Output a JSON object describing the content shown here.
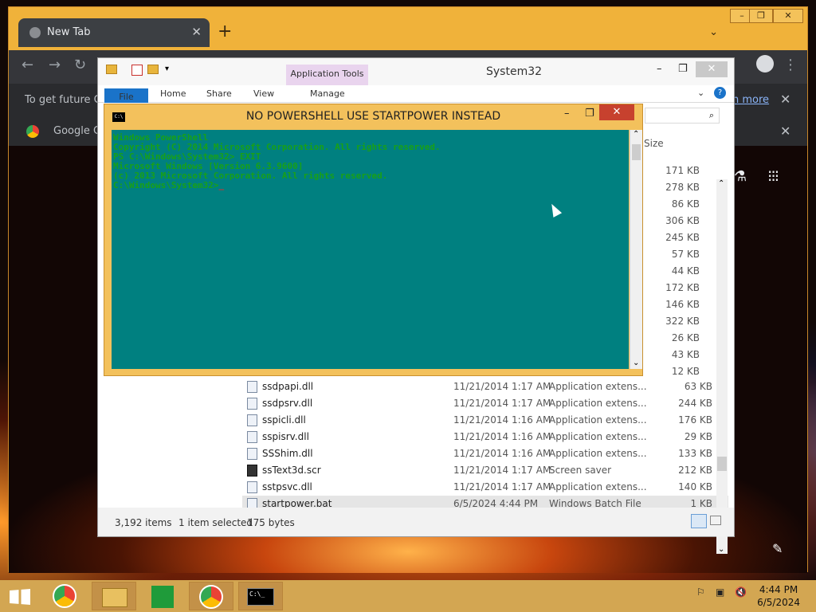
{
  "chrome": {
    "tab_title": "New Tab",
    "tab_close": "✕",
    "new_tab": "+",
    "info_text": "To get future Go",
    "info_link": "n more",
    "bookmark_label": "Google Ch",
    "close_glyph": "✕"
  },
  "explorer": {
    "title": "System32",
    "app_tools": "Application Tools",
    "ribbon": {
      "file": "File",
      "home": "Home",
      "share": "Share",
      "view": "View",
      "manage": "Manage"
    },
    "size_header": "Size",
    "upper_sizes": [
      "171 KB",
      "278 KB",
      "86 KB",
      "306 KB",
      "245 KB",
      "57 KB",
      "44 KB",
      "172 KB",
      "146 KB",
      "322 KB",
      "26 KB",
      "43 KB",
      "12 KB"
    ],
    "files": [
      {
        "name": "ssdpapi.dll",
        "date": "11/21/2014 1:17 AM",
        "type": "Application extens...",
        "size": "63 KB"
      },
      {
        "name": "ssdpsrv.dll",
        "date": "11/21/2014 1:17 AM",
        "type": "Application extens...",
        "size": "244 KB"
      },
      {
        "name": "sspicli.dll",
        "date": "11/21/2014 1:16 AM",
        "type": "Application extens...",
        "size": "176 KB"
      },
      {
        "name": "sspisrv.dll",
        "date": "11/21/2014 1:16 AM",
        "type": "Application extens...",
        "size": "29 KB"
      },
      {
        "name": "SSShim.dll",
        "date": "11/21/2014 1:16 AM",
        "type": "Application extens...",
        "size": "133 KB"
      },
      {
        "name": "ssText3d.scr",
        "date": "11/21/2014 1:17 AM",
        "type": "Screen saver",
        "size": "212 KB"
      },
      {
        "name": "sstpsvc.dll",
        "date": "11/21/2014 1:17 AM",
        "type": "Application extens...",
        "size": "140 KB"
      },
      {
        "name": "startpower.bat",
        "date": "6/5/2024 4:44 PM",
        "type": "Windows Batch File",
        "size": "1 KB"
      }
    ],
    "status": {
      "count": "3,192 items",
      "selected": "1 item selected",
      "bytes": "175 bytes"
    }
  },
  "cmd": {
    "title": "NO POWERSHELL USE STARTPOWER INSTEAD",
    "lines": [
      "Windows PowerShell",
      "Copyright (C) 2014 Microsoft Corporation. All rights reserved.",
      "",
      "PS C:\\Windows\\System32> EXIT",
      "Microsoft Windows [Version 6.3.9600]",
      "(c) 2013 Microsoft Corporation. All rights reserved.",
      "",
      "C:\\Windows\\System32>"
    ]
  },
  "taskbar": {
    "time": "4:44 PM",
    "date": "6/5/2024"
  },
  "colors": {
    "window_frame": "#f0b23a",
    "console_bg": "#008080",
    "console_text": "#18a018",
    "taskbar": "#d3a652"
  }
}
